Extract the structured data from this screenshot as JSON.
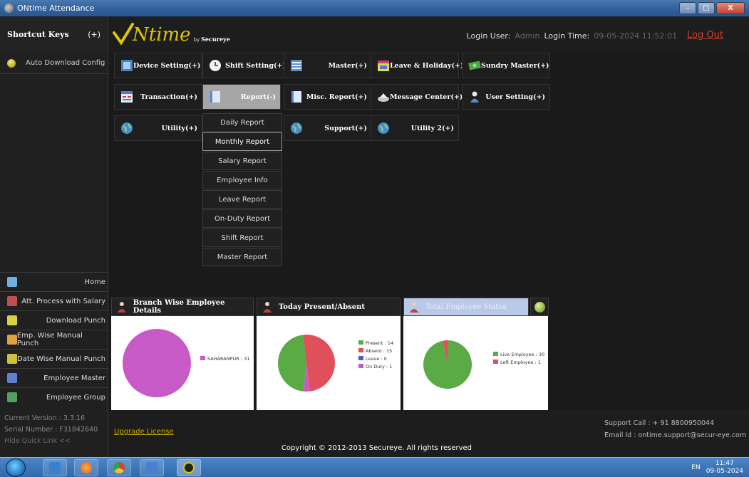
{
  "window": {
    "title": "ONtime Attendance",
    "min": "–",
    "max": "□",
    "close": "X"
  },
  "header": {
    "shortcut_keys": "Shortcut Keys",
    "shortcut_plus": "(+)",
    "logo_text": "Ntime",
    "logo_by": "by",
    "logo_brand": "Secureye",
    "login_user_label": "Login User:",
    "login_user_value": "Admin",
    "login_time_label": "Login Time:",
    "login_time_value": "09-05-2024 11:52:01",
    "logout": "Log Out"
  },
  "sidebar": {
    "auto_download": "Auto Download Config",
    "quick_links": [
      {
        "label": "Home",
        "icon": "home-icon",
        "color": "#6fb0e0"
      },
      {
        "label": "Att. Process with Salary",
        "icon": "calculator-icon",
        "color": "#c05050"
      },
      {
        "label": "Download Punch",
        "icon": "download-icon",
        "color": "#d8d040"
      },
      {
        "label": "Emp. Wise Manual Punch",
        "icon": "user-punch-icon",
        "color": "#e0a040"
      },
      {
        "label": "Date Wise Manual Punch",
        "icon": "calendar-punch-icon",
        "color": "#d0c040"
      },
      {
        "label": "Employee Master",
        "icon": "employee-icon",
        "color": "#6080d0"
      },
      {
        "label": "Employee Group",
        "icon": "group-icon",
        "color": "#50a060"
      }
    ],
    "current_version": "Current Version :  3.3.16",
    "serial_number": "Serial Number   : F31842640",
    "hide_quick_link": "Hide Quick Link <<"
  },
  "modules": {
    "device_setting": "Device Setting(+)",
    "shift_setting": "Shift Setting(+)",
    "master": "Master(+)",
    "leave_holiday": "Leave & Holiday(+)",
    "sundry_master": "Sundry Master(+)",
    "transaction": "Transaction(+)",
    "report": "Report(-)",
    "misc_report": "Misc. Report(+)",
    "message_center": "Message Center(+)",
    "user_setting": "User Setting(+)",
    "utility": "Utility(+)",
    "support": "Support(+)",
    "utility2": "Utility 2(+)"
  },
  "report_menu": [
    "Daily Report",
    "Monthly Report",
    "Salary Report",
    "Employee Info",
    "Leave Report",
    "On-Duty Report",
    "Shift Report",
    "Master Report"
  ],
  "panels": {
    "branch_title": "Branch Wise Employee Details",
    "today_title": "Today Present/Absent",
    "total_title": "Total Employee Status"
  },
  "chart_data": [
    {
      "type": "pie",
      "categories": [
        "SAHARANPUR"
      ],
      "values": [
        31
      ],
      "legend": [
        "SAHARANPUR : 31"
      ],
      "colors": [
        "#c85ac8"
      ]
    },
    {
      "type": "pie",
      "categories": [
        "Present",
        "Absent",
        "Leave",
        "On Duty"
      ],
      "values": [
        14,
        15,
        0,
        1
      ],
      "legend": [
        "Present : 14",
        "Absent : 15",
        "Leave : 0",
        "On Duty : 1"
      ],
      "colors": [
        "#5aaa46",
        "#e0505a",
        "#4060d0",
        "#c85ac8"
      ]
    },
    {
      "type": "pie",
      "categories": [
        "Live Employee",
        "Left Employee"
      ],
      "values": [
        30,
        1
      ],
      "legend": [
        "Live Employee : 30",
        "Left Employee : 1"
      ],
      "colors": [
        "#5aaa46",
        "#e0505a"
      ]
    }
  ],
  "footer": {
    "upgrade": "Upgrade License",
    "support_call": "Support Call :  + 91 8800950044",
    "email": "Email Id       :  ontime.support@secur-eye.com",
    "copyright": "Copyright © 2012-2013 Secureye. All rights reserved"
  },
  "taskbar": {
    "lang": "EN",
    "time": "11:47",
    "date": "09-05-2024"
  }
}
